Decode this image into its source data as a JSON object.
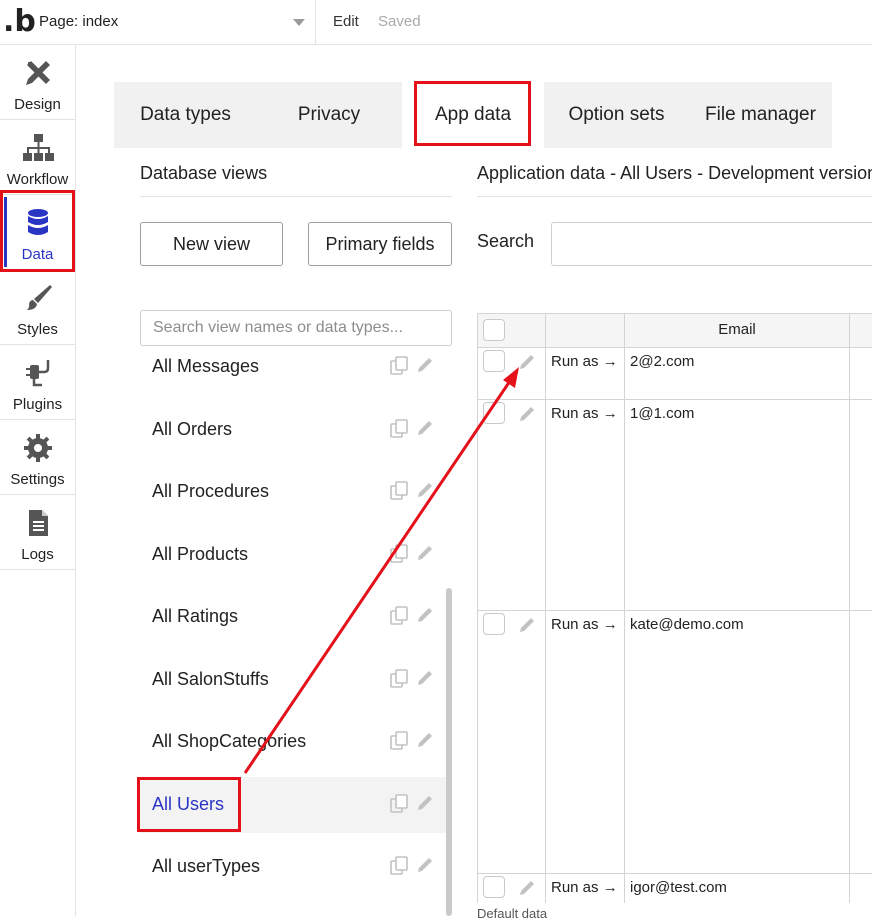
{
  "topbar": {
    "page_label": "Page: index",
    "edit_label": "Edit",
    "saved_label": "Saved",
    "logo_text": ".b"
  },
  "nav": [
    {
      "label": "Design",
      "icon": "design-icon"
    },
    {
      "label": "Workflow",
      "icon": "workflow-icon"
    },
    {
      "label": "Data",
      "icon": "database-icon",
      "active": true
    },
    {
      "label": "Styles",
      "icon": "brush-icon"
    },
    {
      "label": "Plugins",
      "icon": "plug-icon"
    },
    {
      "label": "Settings",
      "icon": "gear-icon"
    },
    {
      "label": "Logs",
      "icon": "document-icon"
    }
  ],
  "tabs": [
    {
      "label": "Data types"
    },
    {
      "label": "Privacy"
    },
    {
      "label": "App data",
      "active": true
    },
    {
      "label": "Option sets"
    },
    {
      "label": "File manager"
    }
  ],
  "database_views": {
    "title": "Database views",
    "new_view_label": "New view",
    "primary_fields_label": "Primary fields",
    "search_placeholder": "Search view names or data types...",
    "items": [
      {
        "label": "All Messages"
      },
      {
        "label": "All Orders"
      },
      {
        "label": "All Procedures"
      },
      {
        "label": "All Products"
      },
      {
        "label": "All Ratings"
      },
      {
        "label": "All SalonStuffs"
      },
      {
        "label": "All ShopCategories"
      },
      {
        "label": "All Users",
        "selected": true
      },
      {
        "label": "All userTypes"
      }
    ]
  },
  "app_data": {
    "title": "Application data - All Users - Development version",
    "search_label": "Search",
    "columns": {
      "email": "Email"
    },
    "rows": [
      {
        "run_as": "Run as →",
        "email": "2@2.com"
      },
      {
        "run_as": "Run as →",
        "email": "1@1.com"
      },
      {
        "run_as": "Run as →",
        "email": "kate@demo.com"
      },
      {
        "run_as": "Run as →",
        "email": "igor@test.com"
      }
    ],
    "footer_text": "Default data"
  },
  "colors": {
    "accent": "#2b35c4",
    "annotation": "#e4101a",
    "tab_bg": "#f1f1f1"
  }
}
